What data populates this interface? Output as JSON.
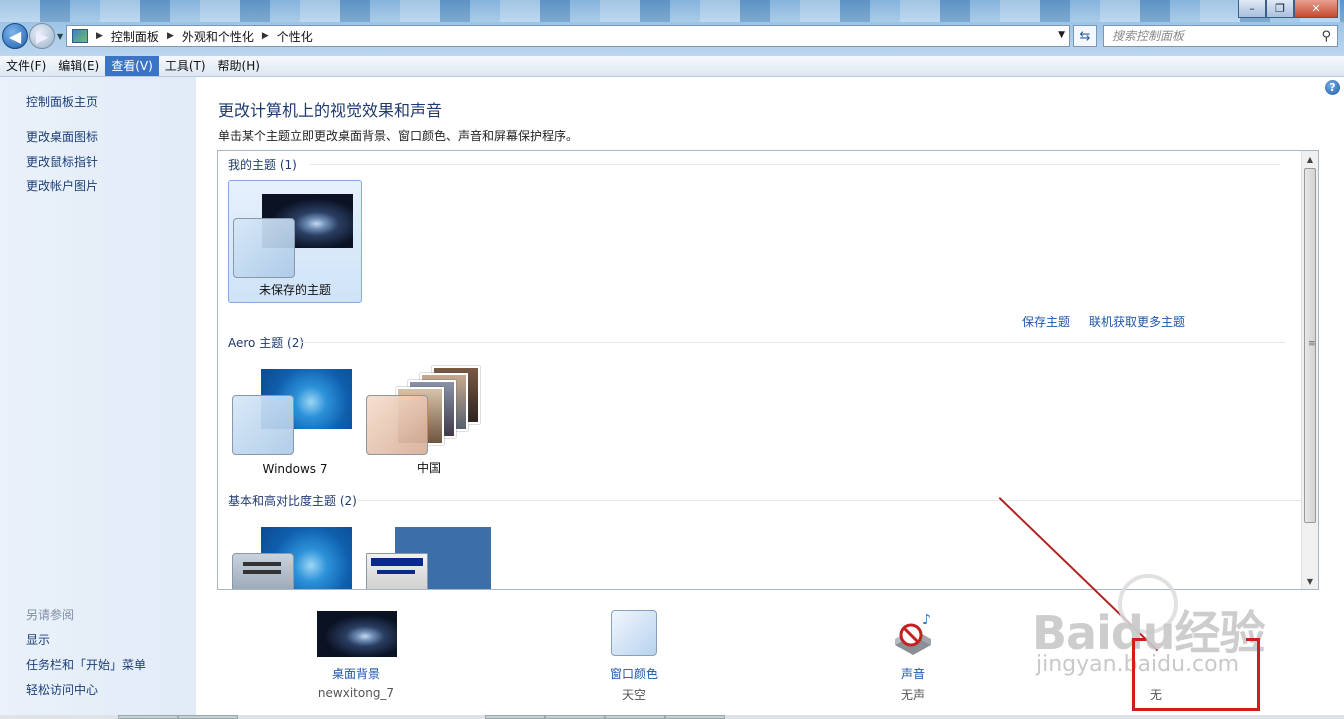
{
  "breadcrumb": [
    "控制面板",
    "外观和个性化",
    "个性化"
  ],
  "search": {
    "placeholder": "搜索控制面板"
  },
  "window_buttons": {
    "minimize": "–",
    "maximize": "❐",
    "close": "✕"
  },
  "menubar": [
    "文件(F)",
    "编辑(E)",
    "查看(V)",
    "工具(T)",
    "帮助(H)"
  ],
  "menubar_active_index": 2,
  "sidebar": {
    "home": "控制面板主页",
    "tasks": [
      "更改桌面图标",
      "更改鼠标指针",
      "更改帐户图片"
    ],
    "see_also_title": "另请参阅",
    "see_also": [
      "显示",
      "任务栏和「开始」菜单",
      "轻松访问中心"
    ]
  },
  "main": {
    "title": "更改计算机上的视觉效果和声音",
    "description": "单击某个主题立即更改桌面背景、窗口颜色、声音和屏幕保护程序。",
    "help_label": "?"
  },
  "themes": {
    "my_themes": {
      "header": "我的主题 (1)",
      "items": [
        "未保存的主题"
      ]
    },
    "save_theme": "保存主题",
    "get_more": "联机获取更多主题",
    "aero": {
      "header": "Aero 主题 (2)",
      "items": [
        "Windows 7",
        "中国"
      ]
    },
    "basic": {
      "header": "基本和高对比度主题 (2)"
    }
  },
  "settings": {
    "background": {
      "label": "桌面背景",
      "value": "newxitong_7"
    },
    "color": {
      "label": "窗口颜色",
      "value": "天空"
    },
    "sound": {
      "label": "声音",
      "value": "无声"
    },
    "screensaver": {
      "value": "无"
    }
  },
  "watermark": {
    "text": "Baidu经验",
    "url": "jingyan.baidu.com"
  },
  "colors": {
    "accent": "#1e55a8",
    "title": "#1e3a6e",
    "annotation": "#d21d1d"
  }
}
